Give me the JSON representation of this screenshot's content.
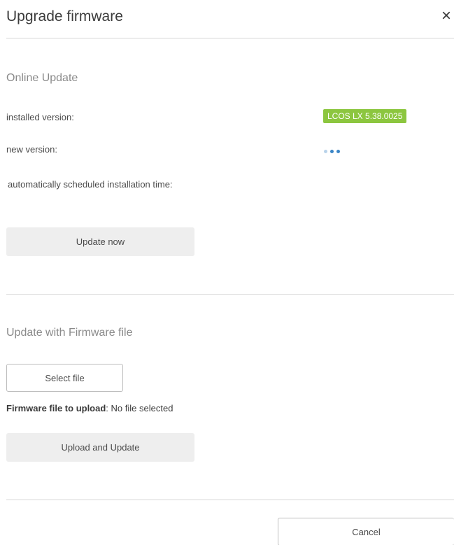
{
  "dialog": {
    "title": "Upgrade firmware",
    "close_glyph": "×",
    "close_icon": "close-icon"
  },
  "online_update": {
    "section_title": "Online Update",
    "installed_version_label": "installed version:",
    "installed_version_value": "LCOS LX 5.38.0025",
    "installed_version_badge_color": "#8cc63f",
    "new_version_label": "new version:",
    "new_version_loading_icon": "loading-dots-icon",
    "scheduled_time_label": "automatically scheduled installation time:",
    "update_now_label": "Update now"
  },
  "file_update": {
    "section_title": "Update with Firmware file",
    "select_file_label": "Select file",
    "file_to_upload_label": "Firmware file to upload",
    "file_to_upload_separator": ":",
    "file_to_upload_value": "No file selected",
    "upload_and_update_label": "Upload and Update"
  },
  "footer": {
    "cancel_label": "Cancel"
  }
}
